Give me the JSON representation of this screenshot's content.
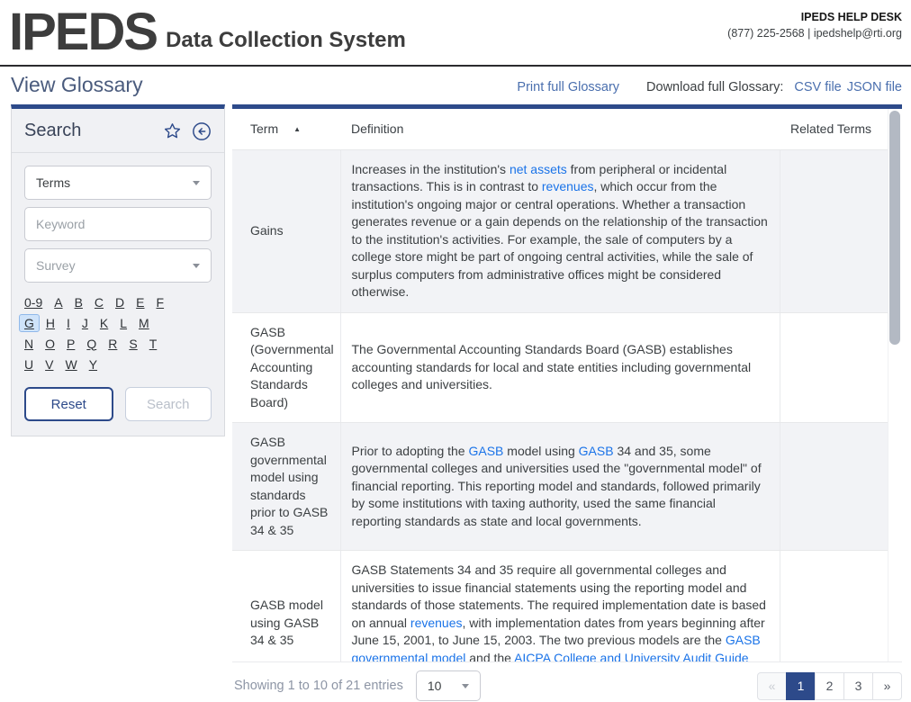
{
  "header": {
    "logo": "IPEDS",
    "subtitle": "Data Collection System",
    "help_desk": "IPEDS HELP DESK",
    "help_contact": "(877) 225-2568 | ipedshelp@rti.org"
  },
  "page": {
    "title": "View Glossary",
    "print_link": "Print full Glossary",
    "download_label": "Download full Glossary:",
    "csv_link": "CSV file",
    "json_link": "JSON file"
  },
  "search_panel": {
    "title": "Search",
    "terms_dropdown": {
      "value": "Terms"
    },
    "keyword_input": {
      "placeholder": "Keyword",
      "value": ""
    },
    "survey_dropdown": {
      "placeholder": "Survey"
    },
    "letter_rows": [
      [
        "0-9",
        "A",
        "B",
        "C",
        "D",
        "E",
        "F"
      ],
      [
        "G",
        "H",
        "I",
        "J",
        "K",
        "L",
        "M"
      ],
      [
        "N",
        "O",
        "P",
        "Q",
        "R",
        "S",
        "T"
      ],
      [
        "U",
        "V",
        "W",
        "Y"
      ]
    ],
    "selected_letter": "G",
    "reset_button": "Reset",
    "search_button": "Search"
  },
  "table": {
    "columns": [
      "Term",
      "Definition",
      "Related Terms"
    ],
    "sort_column": "Term",
    "sort_direction": "ascending",
    "sort_icon": "▲",
    "rows": [
      {
        "term": "Gains",
        "definition": [
          {
            "text": "Increases in the institution's "
          },
          {
            "text": "net assets",
            "link": true
          },
          {
            "text": " from peripheral or incidental transactions. This is in contrast to "
          },
          {
            "text": "revenues",
            "link": true
          },
          {
            "text": ", which occur from the institution's ongoing major or central operations. Whether a transaction generates revenue or a gain depends on the relationship of the transaction to the institution's activities. For example, the sale of computers by a college store might be part of ongoing central activities, while the sale of surplus computers from administrative offices might be considered otherwise."
          }
        ],
        "related_terms": ""
      },
      {
        "term": "GASB (Governmental Accounting Standards Board)",
        "definition": [
          {
            "text": "The Governmental Accounting Standards Board (GASB) establishes accounting standards for local and state entities including governmental colleges and universities."
          }
        ],
        "related_terms": ""
      },
      {
        "term": "GASB governmental model using standards prior to GASB 34 & 35",
        "definition": [
          {
            "text": "Prior to adopting the "
          },
          {
            "text": "GASB",
            "link": true
          },
          {
            "text": " model using "
          },
          {
            "text": "GASB",
            "link": true
          },
          {
            "text": " 34 and 35, some governmental colleges and universities used the \"governmental model\" of financial reporting. This reporting model and standards, followed primarily by some institutions with taxing authority, used the same financial reporting standards as state and local governments."
          }
        ],
        "related_terms": ""
      },
      {
        "term": "GASB model using GASB 34 & 35",
        "definition": [
          {
            "text": "GASB Statements 34 and 35 require all governmental colleges and universities to issue financial statements using the reporting model and standards of those statements. The required implementation date is based on annual "
          },
          {
            "text": "revenues",
            "link": true
          },
          {
            "text": ", with implementation dates from years beginning after June 15, 2001, to June 15, 2003. The two previous models are the "
          },
          {
            "text": "GASB governmental model",
            "link": true
          },
          {
            "text": " and the "
          },
          {
            "text": "AICPA College and University Audit Guide model",
            "link": true
          },
          {
            "text": "."
          }
        ],
        "related_terms": ""
      }
    ]
  },
  "footer": {
    "showing_text": "Showing 1 to 10 of 21 entries",
    "page_size": "10",
    "pagination": [
      {
        "label": "«",
        "state": "disabled"
      },
      {
        "label": "1",
        "state": "active"
      },
      {
        "label": "2",
        "state": "normal"
      },
      {
        "label": "3",
        "state": "normal"
      },
      {
        "label": "»",
        "state": "normal"
      }
    ]
  },
  "colors": {
    "accent_navy": "#2d4a8a",
    "link_blue": "#1a73e8",
    "muted_link_blue": "#4a6fae",
    "row_stripe": "#f2f3f6",
    "title_blue_gray": "#4a5b7d"
  }
}
